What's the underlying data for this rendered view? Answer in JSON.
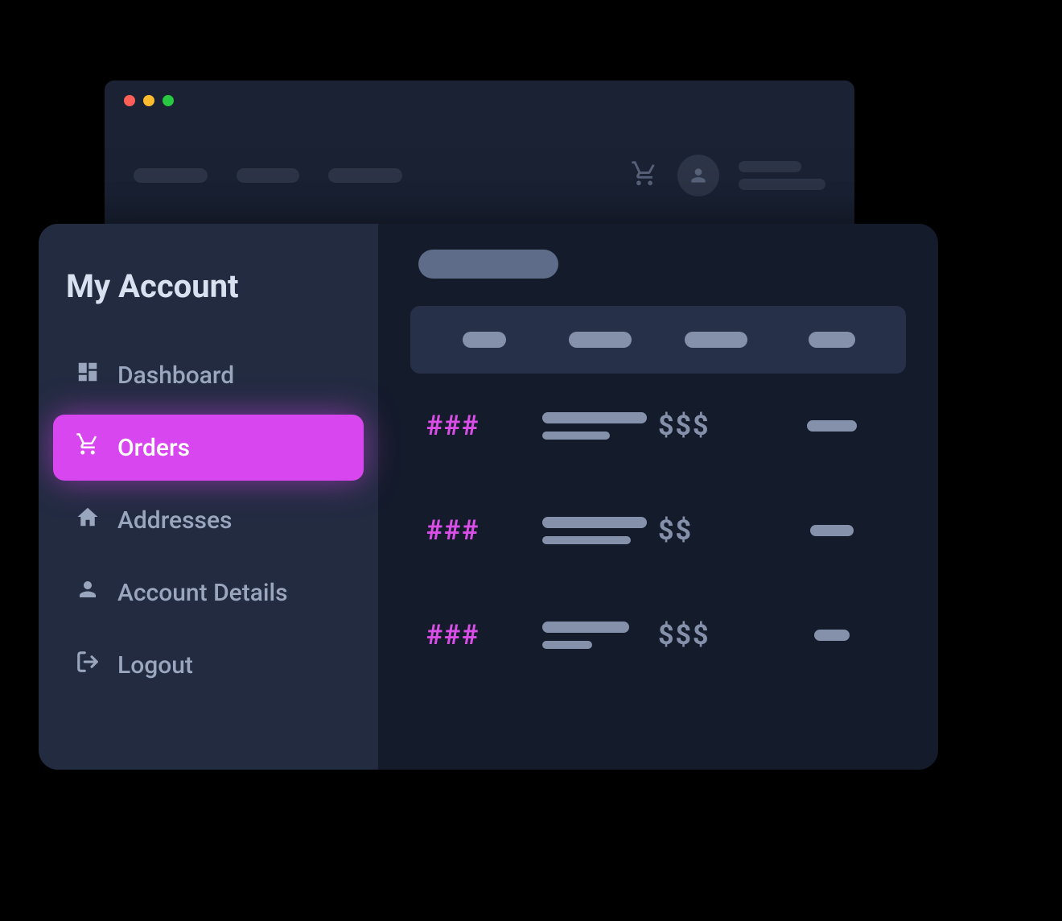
{
  "traffic_lights": [
    "red",
    "yellow",
    "green"
  ],
  "sidebar": {
    "title": "My Account",
    "items": [
      {
        "label": "Dashboard",
        "icon": "dashboard",
        "active": false
      },
      {
        "label": "Orders",
        "icon": "cart",
        "active": true
      },
      {
        "label": "Addresses",
        "icon": "home",
        "active": false
      },
      {
        "label": "Account Details",
        "icon": "user",
        "active": false
      },
      {
        "label": "Logout",
        "icon": "logout",
        "active": false
      }
    ]
  },
  "orders_table": {
    "rows": [
      {
        "id": "###",
        "amount": "$$$"
      },
      {
        "id": "###",
        "amount": "$$"
      },
      {
        "id": "###",
        "amount": "$$$"
      }
    ]
  },
  "colors": {
    "accent": "#d846ef",
    "bg_dark": "#141b2b",
    "bg_sidebar": "#222b40",
    "text_muted": "#9aa6bd"
  }
}
